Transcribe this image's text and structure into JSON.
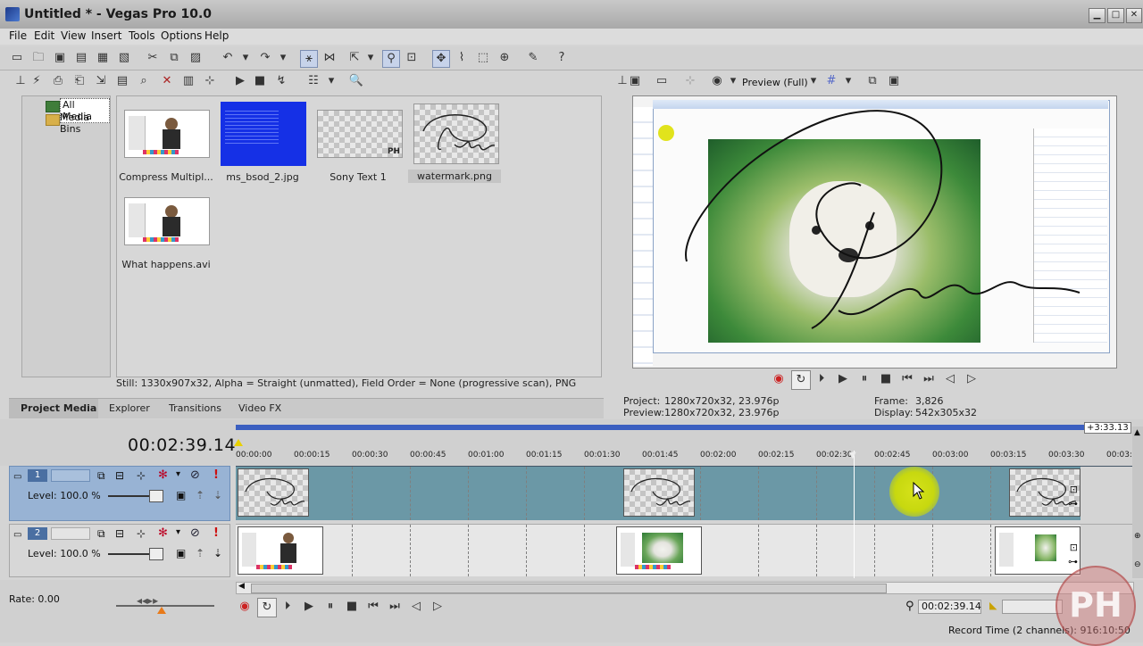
{
  "window": {
    "title": "Untitled * - Vegas Pro 10.0",
    "controls": {
      "minimize": "▁",
      "maximize": "□",
      "close": "✕"
    }
  },
  "menubar": [
    "File",
    "Edit",
    "View",
    "Insert",
    "Tools",
    "Options",
    "Help"
  ],
  "media_tree": {
    "items": [
      {
        "label": "All Media",
        "selected": true
      },
      {
        "label": "Media Bins",
        "selected": false
      }
    ]
  },
  "media": {
    "items": [
      {
        "label": "Compress Multipl..."
      },
      {
        "label": "ms_bsod_2.jpg"
      },
      {
        "label": "Sony Text 1",
        "badge": "PH"
      },
      {
        "label": "watermark.png",
        "selected": true
      },
      {
        "label": "What happens.avi"
      }
    ],
    "status": "Still: 1330x907x32, Alpha = Straight (unmatted), Field Order = None (progressive scan), PNG"
  },
  "tabs": [
    "Project Media",
    "Explorer",
    "Transitions",
    "Video FX"
  ],
  "preview": {
    "mode_label": "Preview (Full)",
    "project_label": "Project:",
    "project_value": "1280x720x32, 23.976p",
    "preview_label": "Preview:",
    "preview_value": "1280x720x32, 23.976p",
    "frame_label": "Frame:",
    "frame_value": "3,826",
    "display_label": "Display:",
    "display_value": "542x305x32"
  },
  "timeline": {
    "timecode": "00:02:39.14",
    "end_marker": "+3:33.13",
    "ruler": [
      "00:00:00",
      "00:00:15",
      "00:00:30",
      "00:00:45",
      "00:01:00",
      "00:01:15",
      "00:01:30",
      "00:01:45",
      "00:02:00",
      "00:02:15",
      "00:02:30",
      "00:02:45",
      "00:03:00",
      "00:03:15",
      "00:03:30",
      "00:03:"
    ],
    "tracks": [
      {
        "number": "1",
        "level": "Level: 100.0 %"
      },
      {
        "number": "2",
        "level": "Level: 100.0 %"
      }
    ],
    "rate": "Rate: 0.00",
    "cursor_time": "00:02:39.14",
    "record_time": "Record Time (2 channels): 916:10:50"
  },
  "watermark_text": "PH",
  "colors": {
    "track1_bg": "#6b98a6",
    "track2_bg": "#e7e7e7",
    "accent_blue": "#2a52be",
    "highlight_yellow": "#c7d80f"
  }
}
